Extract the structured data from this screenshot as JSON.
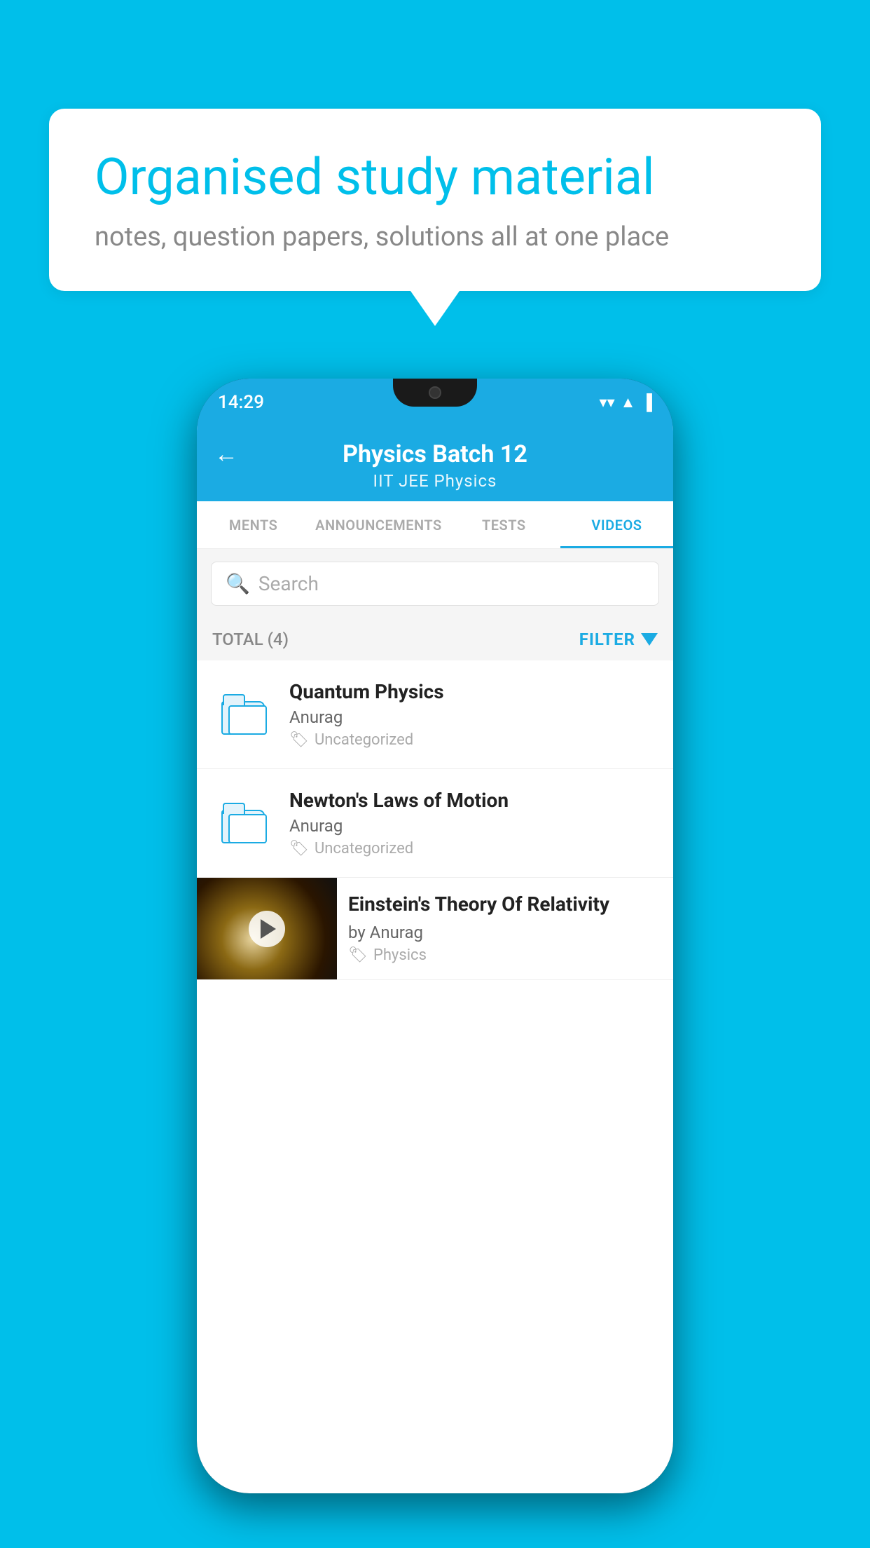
{
  "background": {
    "color": "#00BFEA"
  },
  "speech_bubble": {
    "title": "Organised study material",
    "subtitle": "notes, question papers, solutions all at one place"
  },
  "phone": {
    "status_bar": {
      "time": "14:29",
      "icons": [
        "wifi",
        "signal",
        "battery"
      ]
    },
    "header": {
      "title": "Physics Batch 12",
      "subtitle": "IIT JEE   Physics",
      "back_label": "←"
    },
    "tabs": [
      {
        "label": "MENTS",
        "active": false
      },
      {
        "label": "ANNOUNCEMENTS",
        "active": false
      },
      {
        "label": "TESTS",
        "active": false
      },
      {
        "label": "VIDEOS",
        "active": true
      }
    ],
    "search": {
      "placeholder": "Search"
    },
    "filter_row": {
      "total_label": "TOTAL (4)",
      "filter_label": "FILTER"
    },
    "videos": [
      {
        "id": 1,
        "title": "Quantum Physics",
        "author": "Anurag",
        "tag": "Uncategorized",
        "has_thumbnail": false
      },
      {
        "id": 2,
        "title": "Newton's Laws of Motion",
        "author": "Anurag",
        "tag": "Uncategorized",
        "has_thumbnail": false
      },
      {
        "id": 3,
        "title": "Einstein's Theory Of Relativity",
        "author": "by Anurag",
        "tag": "Physics",
        "has_thumbnail": true
      }
    ]
  }
}
